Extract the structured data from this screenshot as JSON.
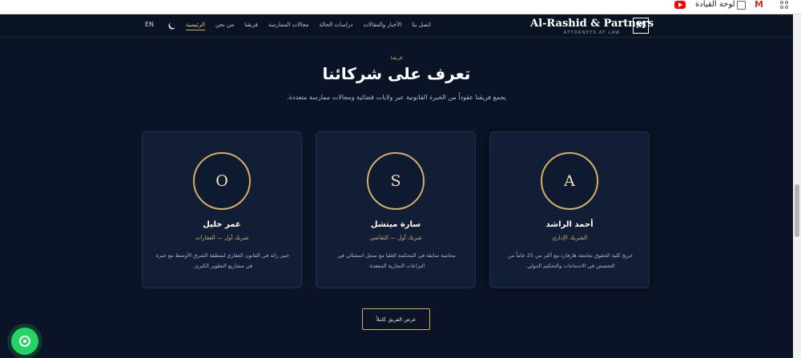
{
  "bookmarks": {
    "dashboard_label": "لوحة القيادة",
    "icons": [
      "youtube-icon",
      "folder-icon",
      "gmail-icon",
      "apps-icon"
    ]
  },
  "header": {
    "brand_name": "Al-Rashid & Partners",
    "brand_tagline": "ATTORNEYS AT LAW",
    "logo_letter": "M",
    "language": "EN",
    "nav": [
      {
        "label": "الرئيسية",
        "active": true
      },
      {
        "label": "من نحن"
      },
      {
        "label": "فريقنا"
      },
      {
        "label": "مجالات الممارسة"
      },
      {
        "label": "دراسات الحالة"
      },
      {
        "label": "الأخبار والمقالات"
      },
      {
        "label": "اتصل بنا"
      }
    ]
  },
  "section": {
    "kicker": "فريقنا",
    "title": "تعرف على شركائنا",
    "subtitle": "يجمع فريقنا عقوداً من الخبرة القانونية عبر ولايات قضائية ومجالات ممارسة متعددة."
  },
  "partners": [
    {
      "initial": "A",
      "name": "أحمد الراشد",
      "role": "الشريك الإداري",
      "bio": "خريج كلية الحقوق بجامعة هارفارد مع أكثر من 25 عاماً من التخصص في الاندماجات والتحكيم الدولي."
    },
    {
      "initial": "S",
      "name": "سارة ميتشل",
      "role": "شريك أول — التقاضي",
      "bio": "محامية سابقة في المحكمة العليا مع سجل استثنائي في النزاعات التجارية المعقدة."
    },
    {
      "initial": "O",
      "name": "عمر خليل",
      "role": "شريك أول — العقارات",
      "bio": "خبير رائد في القانون العقاري لمنطقة الشرق الأوسط مع خبرة في مشاريع التطوير الكبرى."
    }
  ],
  "cta": {
    "view_team": "عرض الفريق كاملاً"
  },
  "colors": {
    "background": "#0b1426",
    "card": "#121e36",
    "accent_gold": "#d4ae68",
    "whatsapp": "#25d366"
  }
}
